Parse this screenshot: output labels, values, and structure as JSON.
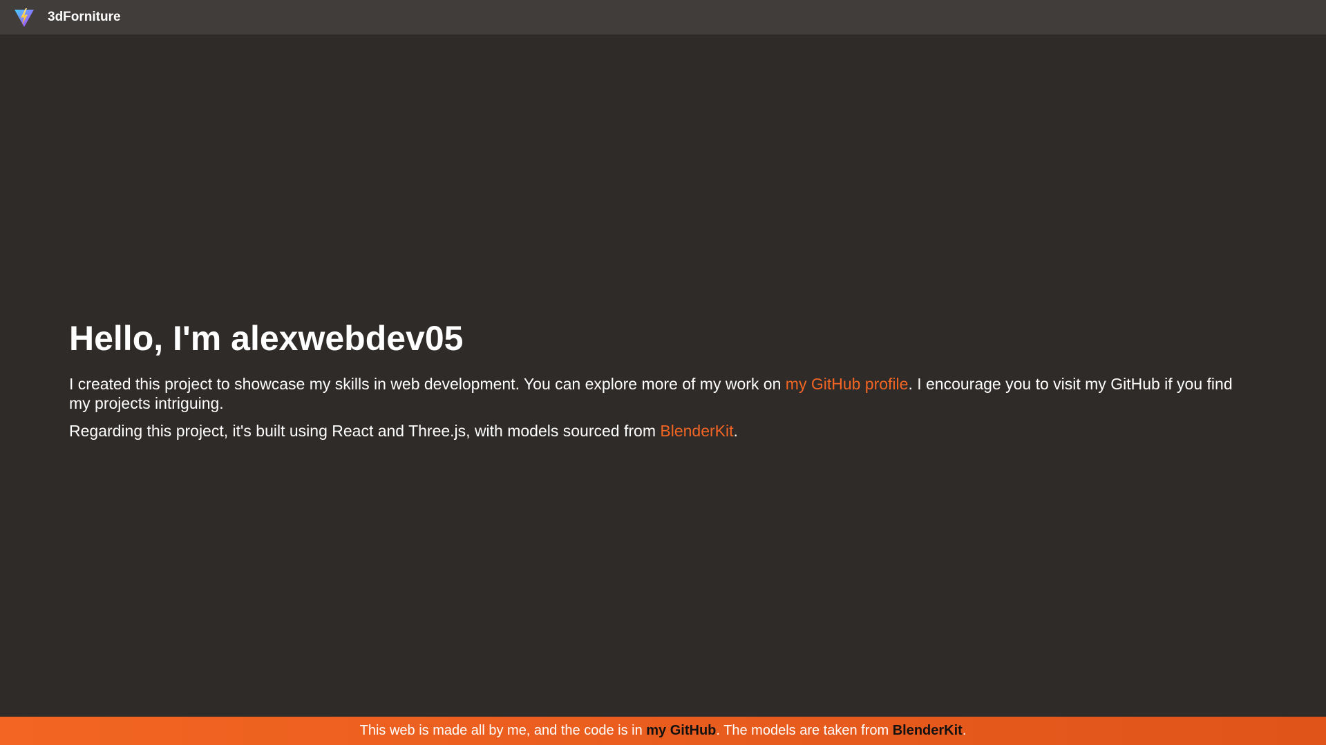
{
  "header": {
    "logo_icon": "vite-logo-icon",
    "brand": "3dForniture"
  },
  "main": {
    "title": "Hello, I'm alexwebdev05",
    "paragraph1": {
      "before": "I created this project to showcase my skills in web development. You can explore more of my work on ",
      "link": "my GitHub profile",
      "after": ". I encourage you to visit my GitHub if you find my projects intriguing."
    },
    "paragraph2": {
      "before": "Regarding this project, it's built using React and Three.js, with models sourced from ",
      "link": "BlenderKit",
      "after": "."
    }
  },
  "footer": {
    "text1": "This web is made all by me, and the code is in ",
    "link1": "my GitHub",
    "text2": ". The models are taken from ",
    "link2": "BlenderKit",
    "text3": "."
  },
  "colors": {
    "background": "#2f2b29",
    "topbar": "#413d3b",
    "accent": "#f26522"
  }
}
